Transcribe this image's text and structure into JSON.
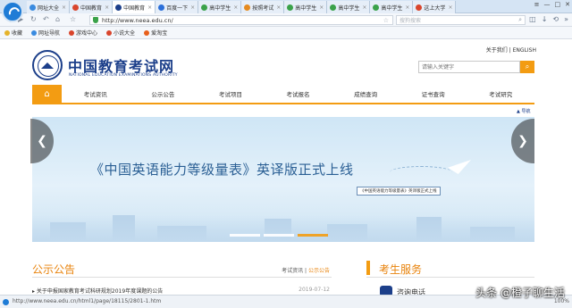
{
  "browser": {
    "tabs": [
      {
        "label": "网址大全",
        "color": "#3a8be0"
      },
      {
        "label": "中国教育",
        "color": "#d9452c"
      },
      {
        "label": "中国教育",
        "color": "#1c3f8a",
        "active": true
      },
      {
        "label": "百度一下",
        "color": "#2b6fd9"
      },
      {
        "label": "高中学生",
        "color": "#3ba24a"
      },
      {
        "label": "按照考试",
        "color": "#e58a1f"
      },
      {
        "label": "高中学生",
        "color": "#3ba24a"
      },
      {
        "label": "高中学生",
        "color": "#3ba24a"
      },
      {
        "label": "高中学生",
        "color": "#3ba24a"
      },
      {
        "label": "这上大学",
        "color": "#d9452c"
      }
    ],
    "window_controls": [
      "≡",
      "—",
      "□",
      "✕"
    ],
    "address": {
      "url": "http://www.neea.edu.cn/"
    },
    "search": {
      "placeholder": "搜狗搜索"
    },
    "bookmarks": [
      {
        "label": "收藏",
        "color": "#e5b32a"
      },
      {
        "label": "网址导航",
        "color": "#3a8be0"
      },
      {
        "label": "游戏中心",
        "color": "#d9452c"
      },
      {
        "label": "小说大全",
        "color": "#d9452c"
      },
      {
        "label": "爱淘宝",
        "color": "#e8601c"
      }
    ],
    "status": {
      "url": "http://www.neea.edu.cn/html1/page/18115/2801-1.htm",
      "zoom": "100%"
    }
  },
  "site": {
    "top_links": "关于我们 | ENGLISH",
    "logo_title": "中国教育考试网",
    "logo_subtitle": "NATIONAL EDUCATION EXAMINATIONS AUTHORITY",
    "search_placeholder": "请输入关键字",
    "nav": [
      "考试资讯",
      "公示公告",
      "考试项目",
      "考试报名",
      "成绩查询",
      "证书查询",
      "考试研究"
    ],
    "util_link": "导航",
    "banner": {
      "headline": "《中国英语能力等级量表》英译版正式上线",
      "tag": "《中国英语能力等级量表》英译版正式上线",
      "slides": 3,
      "active_slide": 3
    },
    "notice": {
      "title": "公示公告",
      "tabs": [
        "考试资讯",
        "公示公告"
      ],
      "active_tab": 1,
      "items": [
        {
          "text": "关于申报国家教育考试科研规划2019年度课题的公告",
          "date": "2019-07-12"
        }
      ]
    },
    "service": {
      "title": "考生服务",
      "first_item": "咨询电话"
    }
  },
  "watermark": "头条 @橙子聊生活",
  "colors": {
    "accent": "#f39c12",
    "brand": "#1c3f8a",
    "title_orange": "#e8830c"
  }
}
